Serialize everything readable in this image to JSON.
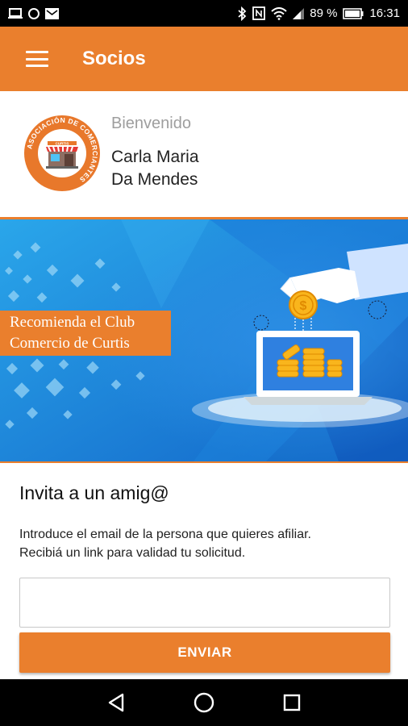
{
  "status_bar": {
    "battery_pct": "89 %",
    "time": "16:31",
    "icons": [
      "laptop-icon",
      "circle-icon",
      "mail-icon",
      "bluetooth-icon",
      "nfc-icon",
      "wifi-icon",
      "signal-icon",
      "battery-icon"
    ]
  },
  "app_bar": {
    "title": "Socios",
    "menu_icon": "menu-icon"
  },
  "profile": {
    "welcome": "Bienvenido",
    "name_line1": "Carla Maria",
    "name_line2": "Da Mendes",
    "logo_text": "ASOCIACIÓN DE COMERCIANTES",
    "logo_sign": "CURTIS"
  },
  "banner": {
    "line1": "Recomienda el Club",
    "line2": "Comercio de Curtis",
    "coin_symbol": "$"
  },
  "invite": {
    "title": "Invita a un amig@",
    "desc_line1": "Introduce el email de la persona que quieres afiliar.",
    "desc_line2": "Recibiá un link para validad tu solicitud.",
    "email_value": "",
    "email_placeholder": "",
    "send_label": "ENVIAR"
  },
  "colors": {
    "accent": "#ea7f2d",
    "banner_blue": "#1e9be0",
    "text_dark": "#222222",
    "text_muted": "#9e9e9e"
  },
  "nav_bar": {
    "icons": [
      "back-icon",
      "home-icon",
      "recents-icon"
    ]
  }
}
